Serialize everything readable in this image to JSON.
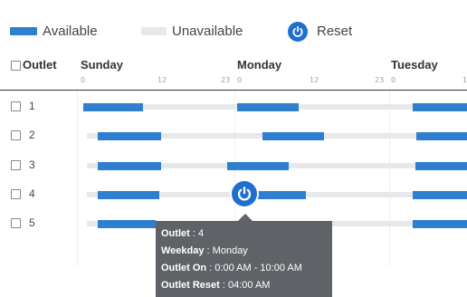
{
  "legend": {
    "available_label": "Available",
    "unavailable_label": "Unavailable",
    "reset_label": "Reset"
  },
  "header": {
    "outlet_label": "Outlet",
    "days": [
      "Sunday",
      "Monday",
      "Tuesday"
    ],
    "ticks": [
      "0",
      "12",
      "23",
      "0",
      "12",
      "23",
      "0",
      "1"
    ]
  },
  "rows": [
    {
      "label": "1"
    },
    {
      "label": "2"
    },
    {
      "label": "3"
    },
    {
      "label": "4"
    },
    {
      "label": "5"
    }
  ],
  "tooltip": {
    "outlet_key": "Outlet",
    "outlet_value": "4",
    "weekday_key": "Weekday",
    "weekday_value": "Monday",
    "on_key": "Outlet On",
    "on_value": "0:00 AM - 10:00 AM",
    "reset_key": "Outlet Reset",
    "reset_value": "04:00 AM"
  },
  "colors": {
    "available": "#2f7fd0",
    "unavailable": "#e6e8eb",
    "reset": "#1f6fd1",
    "tooltip_bg": "#5f6368"
  },
  "icons": {
    "reset": "power-icon",
    "checkbox": "checkbox-unchecked-icon"
  }
}
